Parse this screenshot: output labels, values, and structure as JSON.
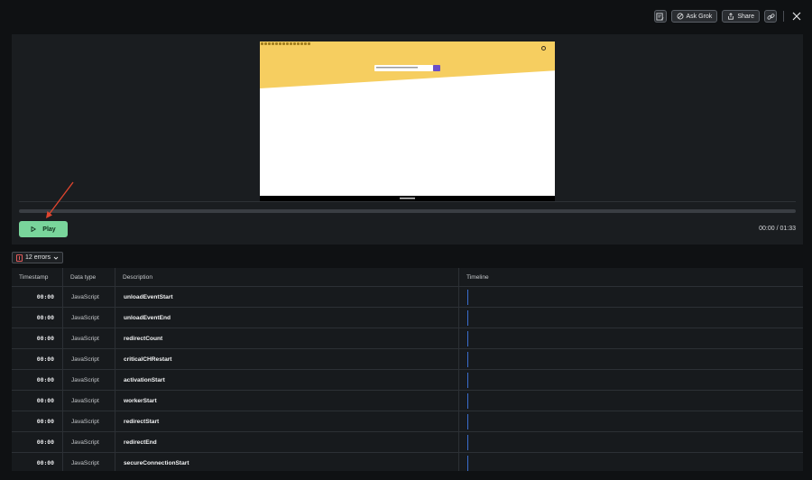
{
  "toolbar": {
    "ask_grok_label": "Ask Grok",
    "share_label": "Share",
    "icons": [
      "edit-icon",
      "grok-icon",
      "share-icon",
      "link-icon",
      "close-icon"
    ]
  },
  "replay": {
    "play_label": "Play",
    "time_readout": "00:00 / 01:33",
    "progress": 0,
    "play_button_color": "#79d59b",
    "preview_banner_color": "#f6ce60",
    "preview_search_button_color": "#6b4fc8"
  },
  "errors": {
    "label": "12 errors",
    "color": "#e25b5b"
  },
  "table": {
    "columns": [
      "Timestamp",
      "Data type",
      "Description",
      "Timeline"
    ],
    "rows": [
      {
        "timestamp": "00:00",
        "type": "JavaScript",
        "description": "unloadEventStart"
      },
      {
        "timestamp": "00:00",
        "type": "JavaScript",
        "description": "unloadEventEnd"
      },
      {
        "timestamp": "00:00",
        "type": "JavaScript",
        "description": "redirectCount"
      },
      {
        "timestamp": "00:00",
        "type": "JavaScript",
        "description": "criticalCHRestart"
      },
      {
        "timestamp": "00:00",
        "type": "JavaScript",
        "description": "activationStart"
      },
      {
        "timestamp": "00:00",
        "type": "JavaScript",
        "description": "workerStart"
      },
      {
        "timestamp": "00:00",
        "type": "JavaScript",
        "description": "redirectStart"
      },
      {
        "timestamp": "00:00",
        "type": "JavaScript",
        "description": "redirectEnd"
      },
      {
        "timestamp": "00:00",
        "type": "JavaScript",
        "description": "secureConnectionStart"
      }
    ],
    "timeline_marker_color": "#3b6fd0"
  }
}
